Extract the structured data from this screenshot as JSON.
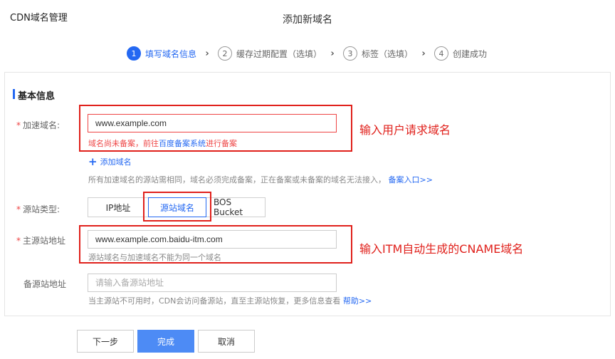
{
  "app": {
    "title": "CDN域名管理"
  },
  "page": {
    "title": "添加新域名"
  },
  "steps": [
    {
      "num": "1",
      "label": "填写域名信息",
      "active": true
    },
    {
      "num": "2",
      "label": "缓存过期配置（选填）",
      "active": false
    },
    {
      "num": "3",
      "label": "标签（选填）",
      "active": false
    },
    {
      "num": "4",
      "label": "创建成功",
      "active": false
    }
  ],
  "section": {
    "title": "基本信息"
  },
  "form": {
    "domain": {
      "label": "加速域名:",
      "required_mark": "*",
      "value": "www.example.com",
      "error_prefix": "域名尚未备案，前往",
      "error_link": "百度备案系统",
      "error_suffix": "进行备案",
      "add_label": "添加域名",
      "hint": "所有加速域名的源站需相同，域名必须完成备案，正在备案或未备案的域名无法接入，",
      "hint_link": "备案入口>>"
    },
    "origin_type": {
      "label": "源站类型:",
      "required_mark": "*",
      "options": [
        "IP地址",
        "源站域名",
        "BOS Bucket"
      ],
      "selected": "源站域名"
    },
    "primary_origin": {
      "label": "主源站地址",
      "required_mark": "*",
      "value": "www.example.com.baidu-itm.com",
      "hint": "源站域名与加速域名不能为同一个域名"
    },
    "backup_origin": {
      "label": "备源站地址",
      "placeholder": "请输入备源站地址",
      "hint": "当主源站不可用时，CDN会访问备源站，直至主源站恢复，更多信息查看",
      "hint_link": "帮助>>"
    }
  },
  "annotations": {
    "domain": "输入用户请求域名",
    "origin": "输入ITM自动生成的CNAME域名"
  },
  "buttons": {
    "next": "下一步",
    "finish": "完成",
    "cancel": "取消"
  },
  "colors": {
    "accent": "#2468f2",
    "annotation": "#e0201b",
    "error": "#e44444",
    "primary_button": "#4d8bf5"
  }
}
